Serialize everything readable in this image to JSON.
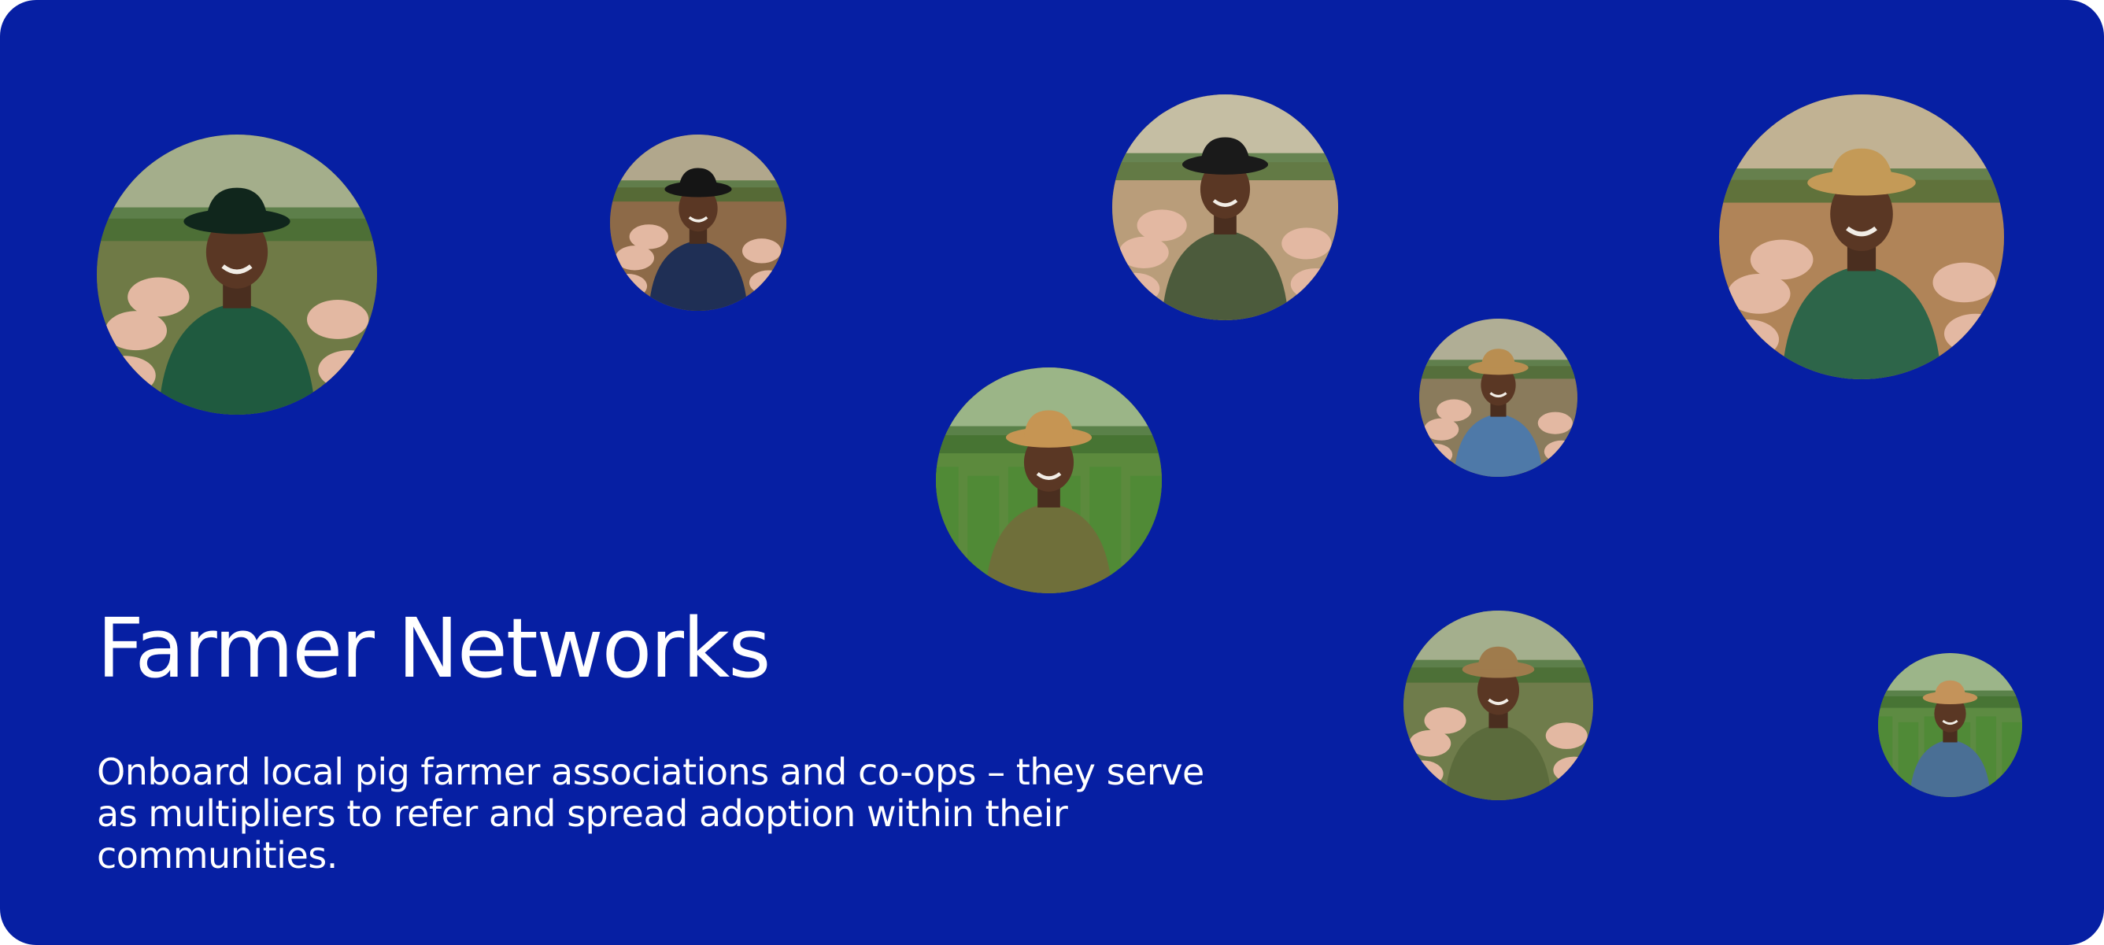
{
  "slide": {
    "title": "Farmer Networks",
    "description": "Onboard local pig farmer associations and co-ops – they serve as multipliers to refer and spread adoption within their communities.",
    "background_color": "#061fa3",
    "text_color": "#ffffff"
  },
  "photos": [
    {
      "name": "farmer-photo-green-hat-pig-pen",
      "shirt": "#1f5a3f",
      "hat": "#10261c",
      "bg": "#6f7a46",
      "pigs": true
    },
    {
      "name": "farmer-photo-suit-pig-barn",
      "shirt": "#1f2f55",
      "hat": "#151515",
      "bg": "#8d6a48",
      "pigs": true
    },
    {
      "name": "farmer-photo-tablet-pig-farm",
      "shirt": "#4c5b3c",
      "hat": "#1a1a1a",
      "bg": "#b99d7a",
      "pigs": true
    },
    {
      "name": "farmer-photo-woman-apron",
      "shirt": "#2d6549",
      "hat": "#c49a57",
      "bg": "#b08458",
      "pigs": true
    },
    {
      "name": "farmer-photo-denim-woman",
      "shirt": "#4e79a8",
      "hat": "#b98e51",
      "bg": "#8a7b5c",
      "pigs": true
    },
    {
      "name": "farmer-photo-overalls-hoe-field",
      "shirt": "#6f6f3a",
      "hat": "#c69553",
      "bg": "#5c8a3d",
      "pigs": false
    },
    {
      "name": "farmer-photo-olive-shirt-cane",
      "shirt": "#5b6b3c",
      "hat": "#9f7b4c",
      "bg": "#6f7c4b",
      "pigs": true
    },
    {
      "name": "farmer-photo-blue-shirt-field",
      "shirt": "#4a6f95",
      "hat": "#c4935a",
      "bg": "#5d8b42",
      "pigs": false
    }
  ]
}
